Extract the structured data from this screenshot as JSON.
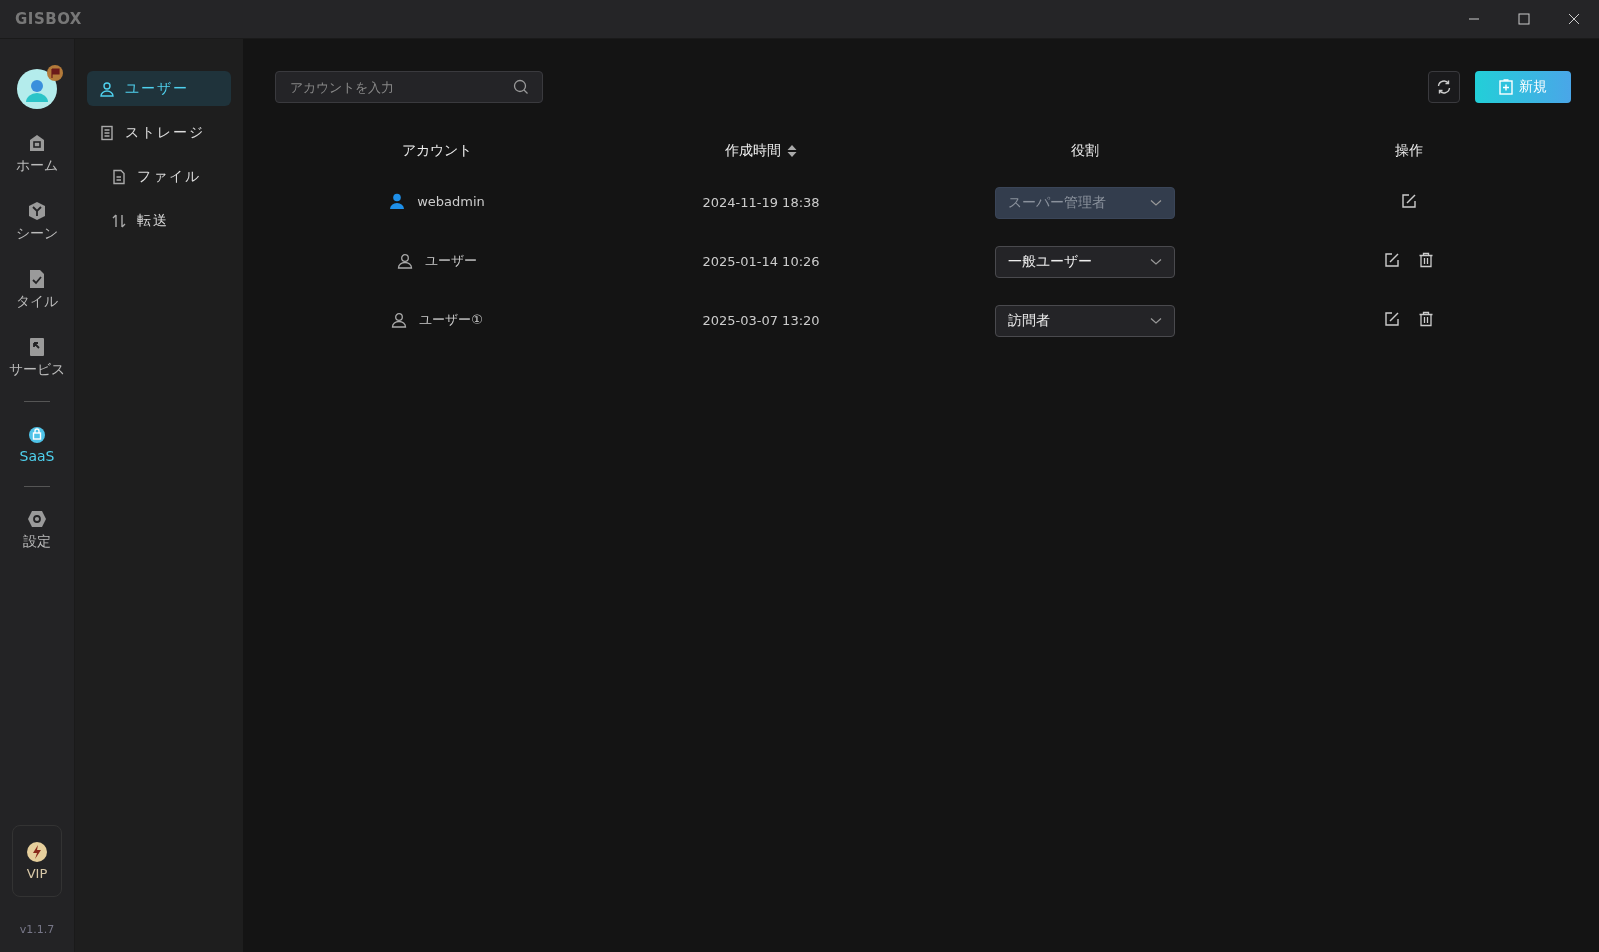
{
  "window": {
    "title": "GISBOX"
  },
  "rail": {
    "groups": [
      [
        {
          "label": "ホーム",
          "kind": "home",
          "selected": false
        },
        {
          "label": "シーン",
          "kind": "scene",
          "selected": false
        },
        {
          "label": "タイル",
          "kind": "tile",
          "selected": false
        },
        {
          "label": "サービス",
          "kind": "service",
          "selected": false
        }
      ],
      [
        {
          "label": "SaaS",
          "kind": "saas",
          "selected": true
        }
      ],
      [
        {
          "label": "設定",
          "kind": "settings",
          "selected": false
        }
      ]
    ],
    "vip": {
      "label": "VIP"
    },
    "version": "v1.1.7"
  },
  "subnav": {
    "items": [
      {
        "label": "ユーザー",
        "kind": "user",
        "selected": true
      },
      {
        "label": "ストレージ",
        "kind": "storage",
        "selected": false,
        "children": [
          {
            "label": "ファイル",
            "kind": "file",
            "selected": false
          },
          {
            "label": "転送",
            "kind": "transfer",
            "selected": false
          }
        ]
      }
    ]
  },
  "search": {
    "placeholder": "アカウントを入力"
  },
  "new_button": {
    "label": "新規"
  },
  "table": {
    "columns": [
      {
        "label": "アカウント",
        "sortable": false
      },
      {
        "label": "作成時間",
        "sortable": true
      },
      {
        "label": "役割",
        "sortable": false
      },
      {
        "label": "操作",
        "sortable": false
      }
    ],
    "rows": [
      {
        "account": "webadmin",
        "kind": "admin",
        "created": "2024-11-19 18:38",
        "role": "スーパー管理者",
        "role_disabled": true,
        "deletable": false
      },
      {
        "account": "ユーザー",
        "kind": "user",
        "created": "2025-01-14 10:26",
        "role": "一般ユーザー",
        "role_disabled": false,
        "deletable": true
      },
      {
        "account": "ユーザー①",
        "kind": "user",
        "created": "2025-03-07 13:20",
        "role": "訪問者",
        "role_disabled": false,
        "deletable": true
      }
    ]
  }
}
